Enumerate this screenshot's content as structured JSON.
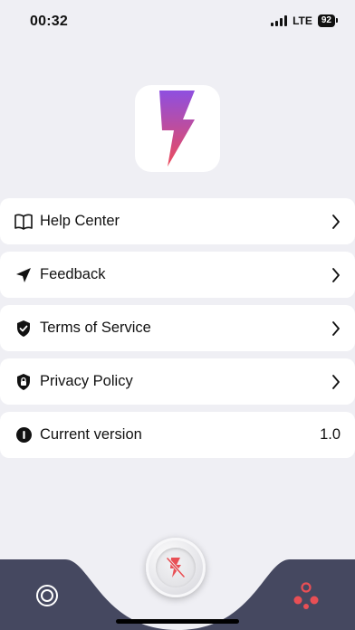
{
  "status_bar": {
    "time": "00:32",
    "network": "LTE",
    "battery": "92"
  },
  "app": {
    "logo_icon": "lightning-bolt-icon",
    "accent_gradient": [
      "#8e4fe0",
      "#ee4b59"
    ]
  },
  "menu": {
    "items": [
      {
        "label": "Help Center",
        "icon": "book-icon"
      },
      {
        "label": "Feedback",
        "icon": "send-icon"
      },
      {
        "label": "Terms of Service",
        "icon": "shield-check-icon"
      },
      {
        "label": "Privacy Policy",
        "icon": "shield-lock-icon"
      }
    ],
    "version": {
      "label": "Current version",
      "value": "1.0",
      "icon": "info-icon"
    }
  },
  "tab_bar": {
    "background": "#454860",
    "left_icon": "target-icon",
    "center_icon": "flash-off-icon",
    "right_icon": "share-nodes-icon",
    "active_color": "#e84f55"
  }
}
